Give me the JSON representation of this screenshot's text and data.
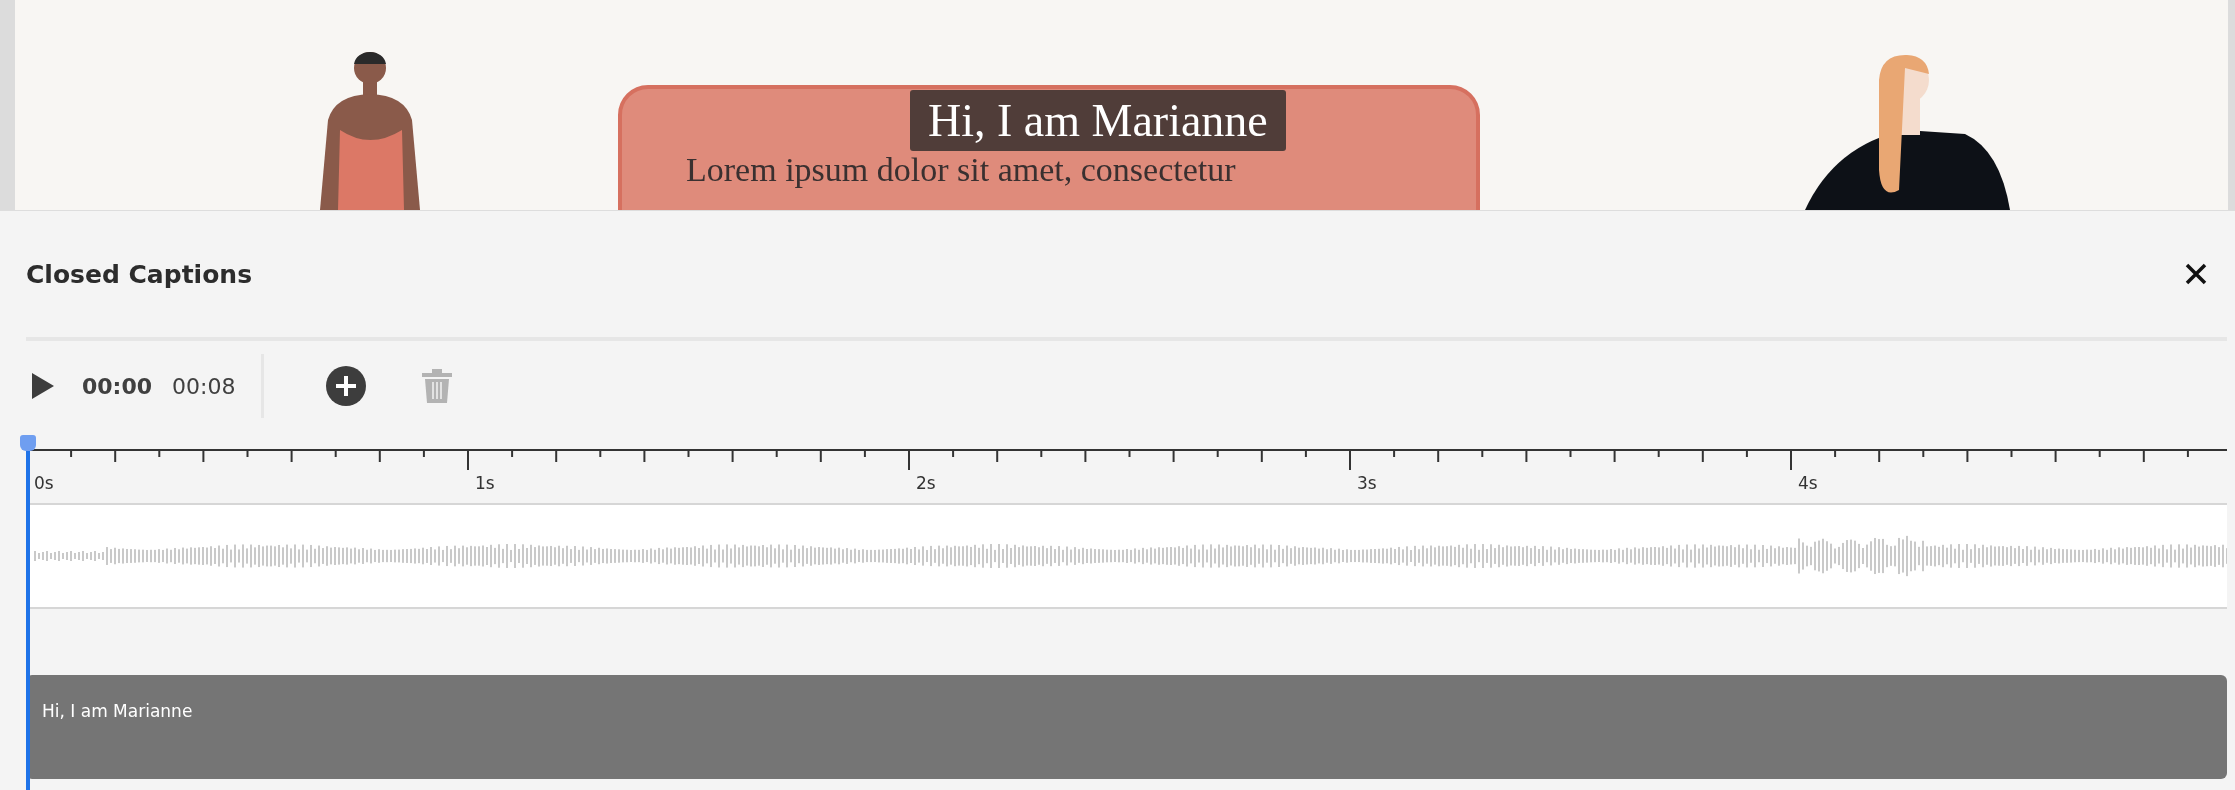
{
  "stage": {
    "slide_text": "Lorem ipsum dolor sit amet, consectetur",
    "caption_overlay": "Hi, I am Marianne"
  },
  "panel": {
    "title": "Closed Captions"
  },
  "toolbar": {
    "current_time": "00:00",
    "duration": "00:08",
    "delete_disabled": true
  },
  "ruler": {
    "labels": [
      "0s",
      "1s",
      "2s",
      "3s",
      "4s"
    ]
  },
  "captions": [
    {
      "text": "Hi, I am Marianne"
    }
  ]
}
